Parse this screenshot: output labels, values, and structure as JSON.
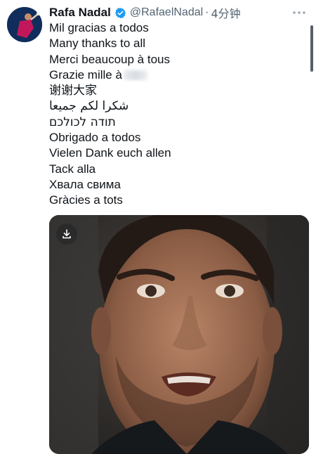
{
  "tweet": {
    "display_name": "Rafa Nadal",
    "handle": "@RafaelNadal",
    "separator": "·",
    "time_ago": "4分钟",
    "verified_color": "#1d9bf0",
    "lines": [
      "Mil gracias a todos",
      "Many thanks to all",
      "Merci beaucoup à tous",
      "Grazie mille à",
      "谢谢大家",
      "شكرا لكم جميعا",
      "תודה לכולכם",
      "Obrigado a todos",
      "Vielen Dank euch allen",
      "Tack alla",
      "Хвала свима",
      "Gràcies a tots"
    ]
  },
  "icons": {
    "more": "more-icon",
    "verified": "verified-badge-icon",
    "download": "download-icon"
  },
  "colors": {
    "text": "#0f1419",
    "secondary": "#536471",
    "brand_blue": "#1d9bf0"
  }
}
